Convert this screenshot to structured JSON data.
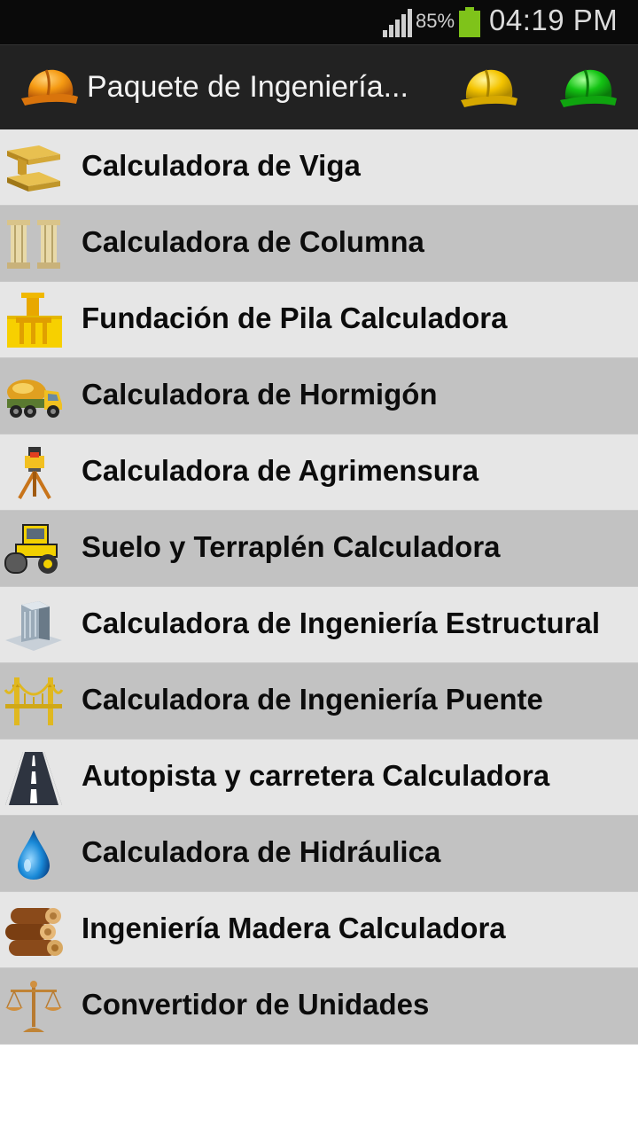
{
  "status_bar": {
    "battery_percent": "85%",
    "time": "04:19 PM",
    "signal_icon": "signal-icon",
    "battery_icon": "battery-icon"
  },
  "action_bar": {
    "title": "Paquete de Ingeniería...",
    "logo_icon": "orange-hard-hat-icon",
    "actions": [
      {
        "icon": "yellow-hard-hat-icon",
        "color": "#f4c400"
      },
      {
        "icon": "green-hard-hat-icon",
        "color": "#14c414"
      }
    ]
  },
  "menu": {
    "items": [
      {
        "label": "Calculadora de Viga",
        "icon": "steel-beam-icon"
      },
      {
        "label": "Calculadora de Columna",
        "icon": "columns-icon"
      },
      {
        "label": "Fundación de Pila Calculadora",
        "icon": "pile-foundation-icon"
      },
      {
        "label": "Calculadora de Hormigón",
        "icon": "concrete-mixer-truck-icon"
      },
      {
        "label": "Calculadora de Agrimensura",
        "icon": "surveying-tripod-icon"
      },
      {
        "label": "Suelo y Terraplén Calculadora",
        "icon": "road-roller-icon"
      },
      {
        "label": "Calculadora de Ingeniería Estructural",
        "icon": "building-icon"
      },
      {
        "label": "Calculadora de Ingeniería Puente",
        "icon": "bridge-icon"
      },
      {
        "label": "Autopista y carretera Calculadora",
        "icon": "highway-icon"
      },
      {
        "label": "Calculadora de Hidráulica",
        "icon": "water-drop-icon"
      },
      {
        "label": "Ingeniería Madera Calculadora",
        "icon": "timber-logs-icon"
      },
      {
        "label": "Convertidor de Unidades",
        "icon": "balance-scale-icon"
      }
    ]
  },
  "colors": {
    "status_bar_bg": "#0a0a0a",
    "action_bar_bg": "#222222",
    "row_light": "#e6e6e6",
    "row_dark": "#c2c2c2",
    "battery_green": "#7fc31a"
  }
}
